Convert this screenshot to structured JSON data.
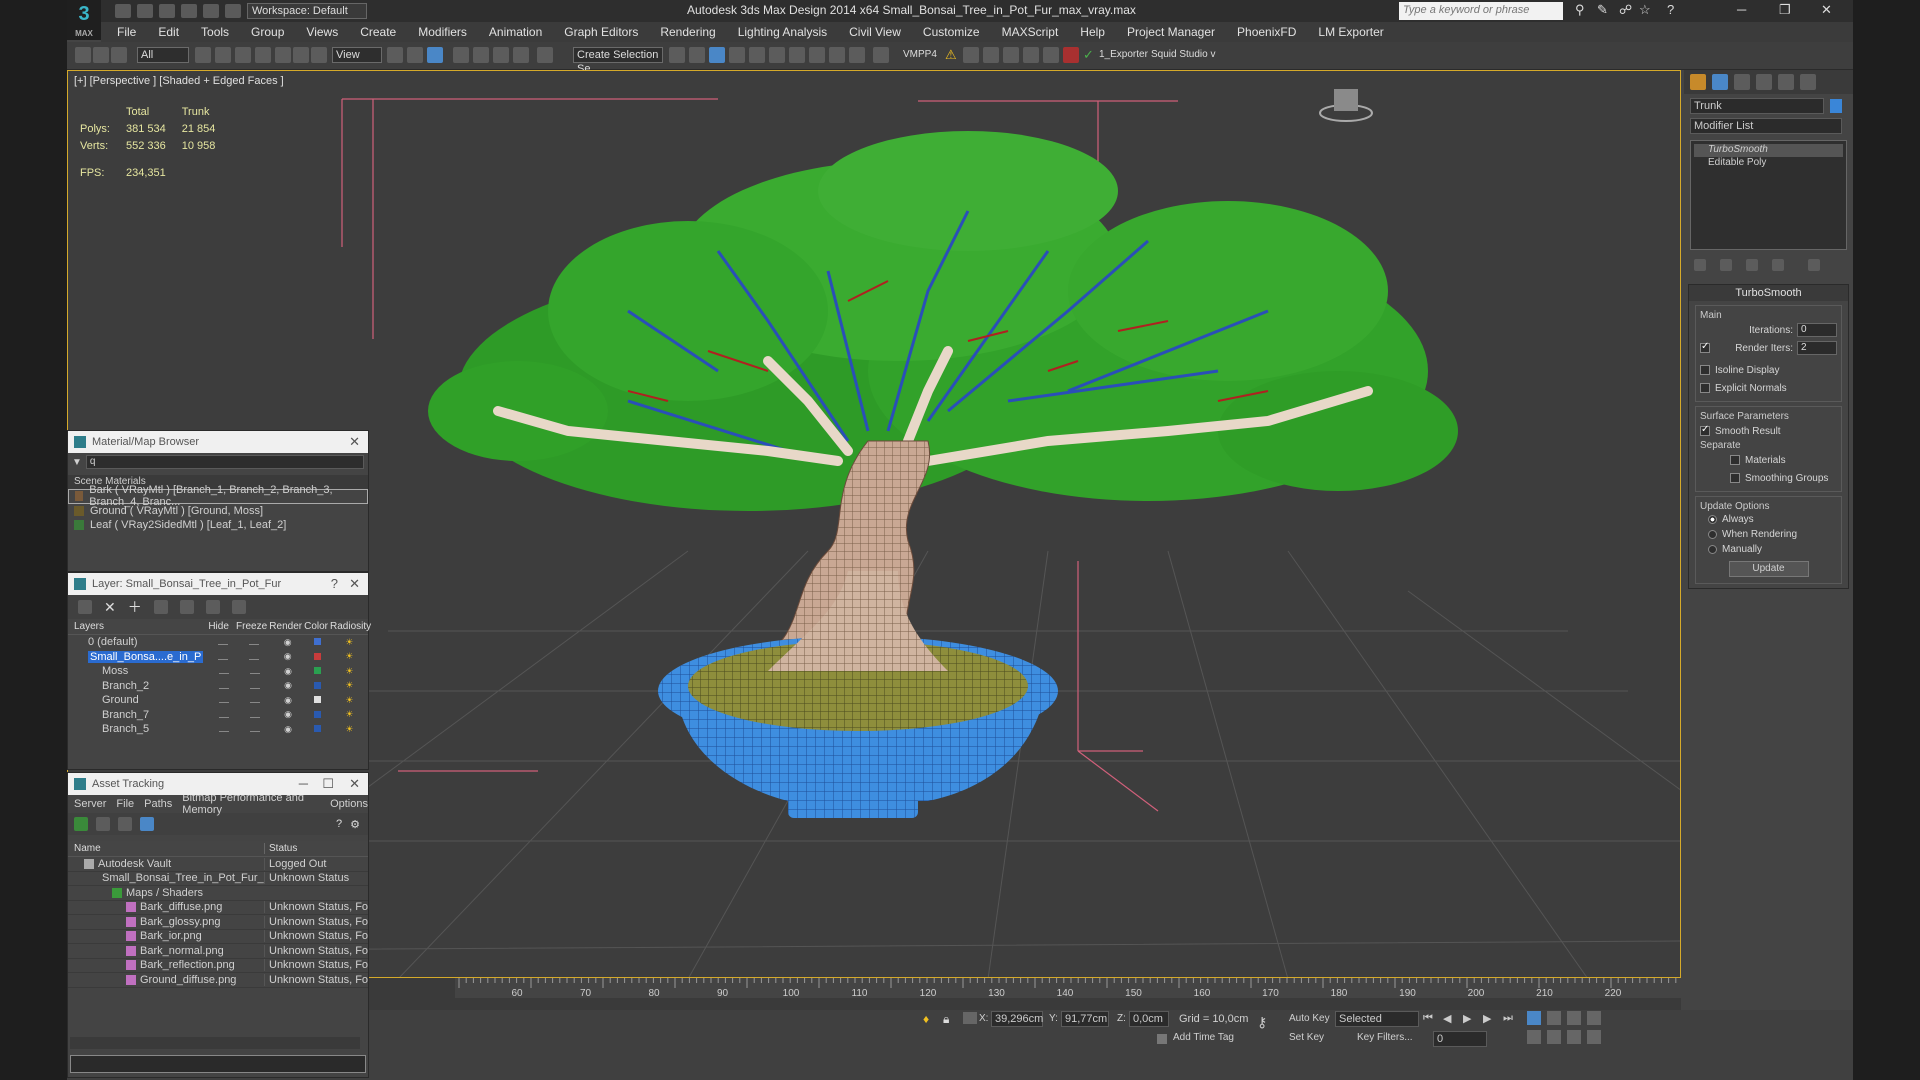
{
  "app": {
    "logo_text": "3",
    "logo_sub": "MAX",
    "workspace": "Workspace: Default",
    "window_title": "Autodesk 3ds Max Design 2014 x64     Small_Bonsai_Tree_in_Pot_Fur_max_vray.max",
    "search_placeholder": "Type a keyword or phrase"
  },
  "menu": [
    "File",
    "Edit",
    "Tools",
    "Group",
    "Views",
    "Create",
    "Modifiers",
    "Animation",
    "Graph Editors",
    "Rendering",
    "Lighting Analysis",
    "Civil View",
    "Customize",
    "MAXScript",
    "Help",
    "Project Manager",
    "PhoenixFD",
    "LM Exporter"
  ],
  "toolbar": {
    "filter": "All",
    "ref_coord": "View",
    "selection_set": "Create Selection Se",
    "vmpp": "VMPP4",
    "exporter": "1_Exporter",
    "squid": "Squid Studio v"
  },
  "viewport": {
    "label": "[+] [Perspective ] [Shaded + Edged Faces ]",
    "stats": {
      "col_total": "Total",
      "col_trunk": "Trunk",
      "polys_label": "Polys:",
      "polys_total": "381 534",
      "polys_trunk": "21 854",
      "verts_label": "Verts:",
      "verts_total": "552 336",
      "verts_trunk": "10 958",
      "fps_label": "FPS:",
      "fps_value": "234,351"
    }
  },
  "timeline": {
    "ticks": [
      "60",
      "70",
      "80",
      "90",
      "100",
      "110",
      "120",
      "130",
      "140",
      "150",
      "160",
      "170",
      "180",
      "190",
      "200",
      "210",
      "220"
    ]
  },
  "status": {
    "x": "39,296cm",
    "y": "91,77cm",
    "z": "0,0cm",
    "grid": "Grid = 10,0cm",
    "autokey": "Auto Key",
    "setkey": "Set Key",
    "selected": "Selected",
    "key_filters": "Key Filters...",
    "add_time_tag": "Add Time Tag",
    "frame": "0",
    "x_lbl": "X:",
    "y_lbl": "Y:",
    "z_lbl": "Z:"
  },
  "command_panel": {
    "object_name": "Trunk",
    "modifier_list": "Modifier List",
    "stack": [
      "TurboSmooth",
      "Editable Poly"
    ],
    "rollout": "TurboSmooth",
    "main": "Main",
    "iterations_label": "Iterations:",
    "iterations": "0",
    "render_iters_label": "Render Iters:",
    "render_iters": "2",
    "isoline": "Isoline Display",
    "explicit_normals": "Explicit Normals",
    "surface_params": "Surface Parameters",
    "smooth_result": "Smooth Result",
    "separate": "Separate",
    "materials": "Materials",
    "smoothing_groups": "Smoothing Groups",
    "update_options": "Update Options",
    "always": "Always",
    "when_rendering": "When Rendering",
    "manually": "Manually",
    "update": "Update"
  },
  "material_browser": {
    "title": "Material/Map Browser",
    "search": "q",
    "section": "Scene Materials",
    "items": [
      "Bark  ( VRayMtl )  [Branch_1, Branch_2, Branch_3, Branch_4, Branc...",
      "Ground  ( VRayMtl )  [Ground, Moss]",
      "Leaf  ( VRay2SidedMtl )  [Leaf_1, Leaf_2]"
    ]
  },
  "layer_panel": {
    "title": "Layer: Small_Bonsai_Tree_in_Pot_Fur",
    "help": "?",
    "columns": [
      "Layers",
      "Hide",
      "Freeze",
      "Render",
      "Color",
      "Radiosity"
    ],
    "rows": [
      {
        "name": "0 (default)",
        "color": "#3f6fd0"
      },
      {
        "name": "Small_Bonsa....e_in_P",
        "color": "#c83c3c"
      },
      {
        "name": "Moss",
        "color": "#2aa050"
      },
      {
        "name": "Branch_2",
        "color": "#2a5ab0"
      },
      {
        "name": "Ground",
        "color": "#e0e0e0"
      },
      {
        "name": "Branch_7",
        "color": "#2a5ab0"
      },
      {
        "name": "Branch_5",
        "color": "#2a5ab0"
      }
    ]
  },
  "asset_tracking": {
    "title": "Asset Tracking",
    "menu": [
      "Server",
      "File",
      "Paths",
      "Bitmap Performance and Memory",
      "Options"
    ],
    "col_name": "Name",
    "col_status": "Status",
    "rows": [
      {
        "name": "Autodesk Vault",
        "status": "Logged Out",
        "indent": 0
      },
      {
        "name": "Small_Bonsai_Tree_in_Pot_Fur_ma...",
        "status": "Unknown Status",
        "indent": 1
      },
      {
        "name": "Maps / Shaders",
        "status": "",
        "indent": 2
      },
      {
        "name": "Bark_diffuse.png",
        "status": "Unknown Status, Four",
        "indent": 3
      },
      {
        "name": "Bark_glossy.png",
        "status": "Unknown Status, Four",
        "indent": 3
      },
      {
        "name": "Bark_ior.png",
        "status": "Unknown Status, Four",
        "indent": 3
      },
      {
        "name": "Bark_normal.png",
        "status": "Unknown Status, Four",
        "indent": 3
      },
      {
        "name": "Bark_reflection.png",
        "status": "Unknown Status, Four",
        "indent": 3
      },
      {
        "name": "Ground_diffuse.png",
        "status": "Unknown Status, Four",
        "indent": 3
      }
    ]
  },
  "colors": {
    "viewport_border": "#d5aa2a",
    "leaf": "#2f9a2a",
    "branch_blue": "#2a4fb8",
    "branch_red": "#b02020",
    "pot": "#3a86d8",
    "soil": "#8a8a3a"
  }
}
